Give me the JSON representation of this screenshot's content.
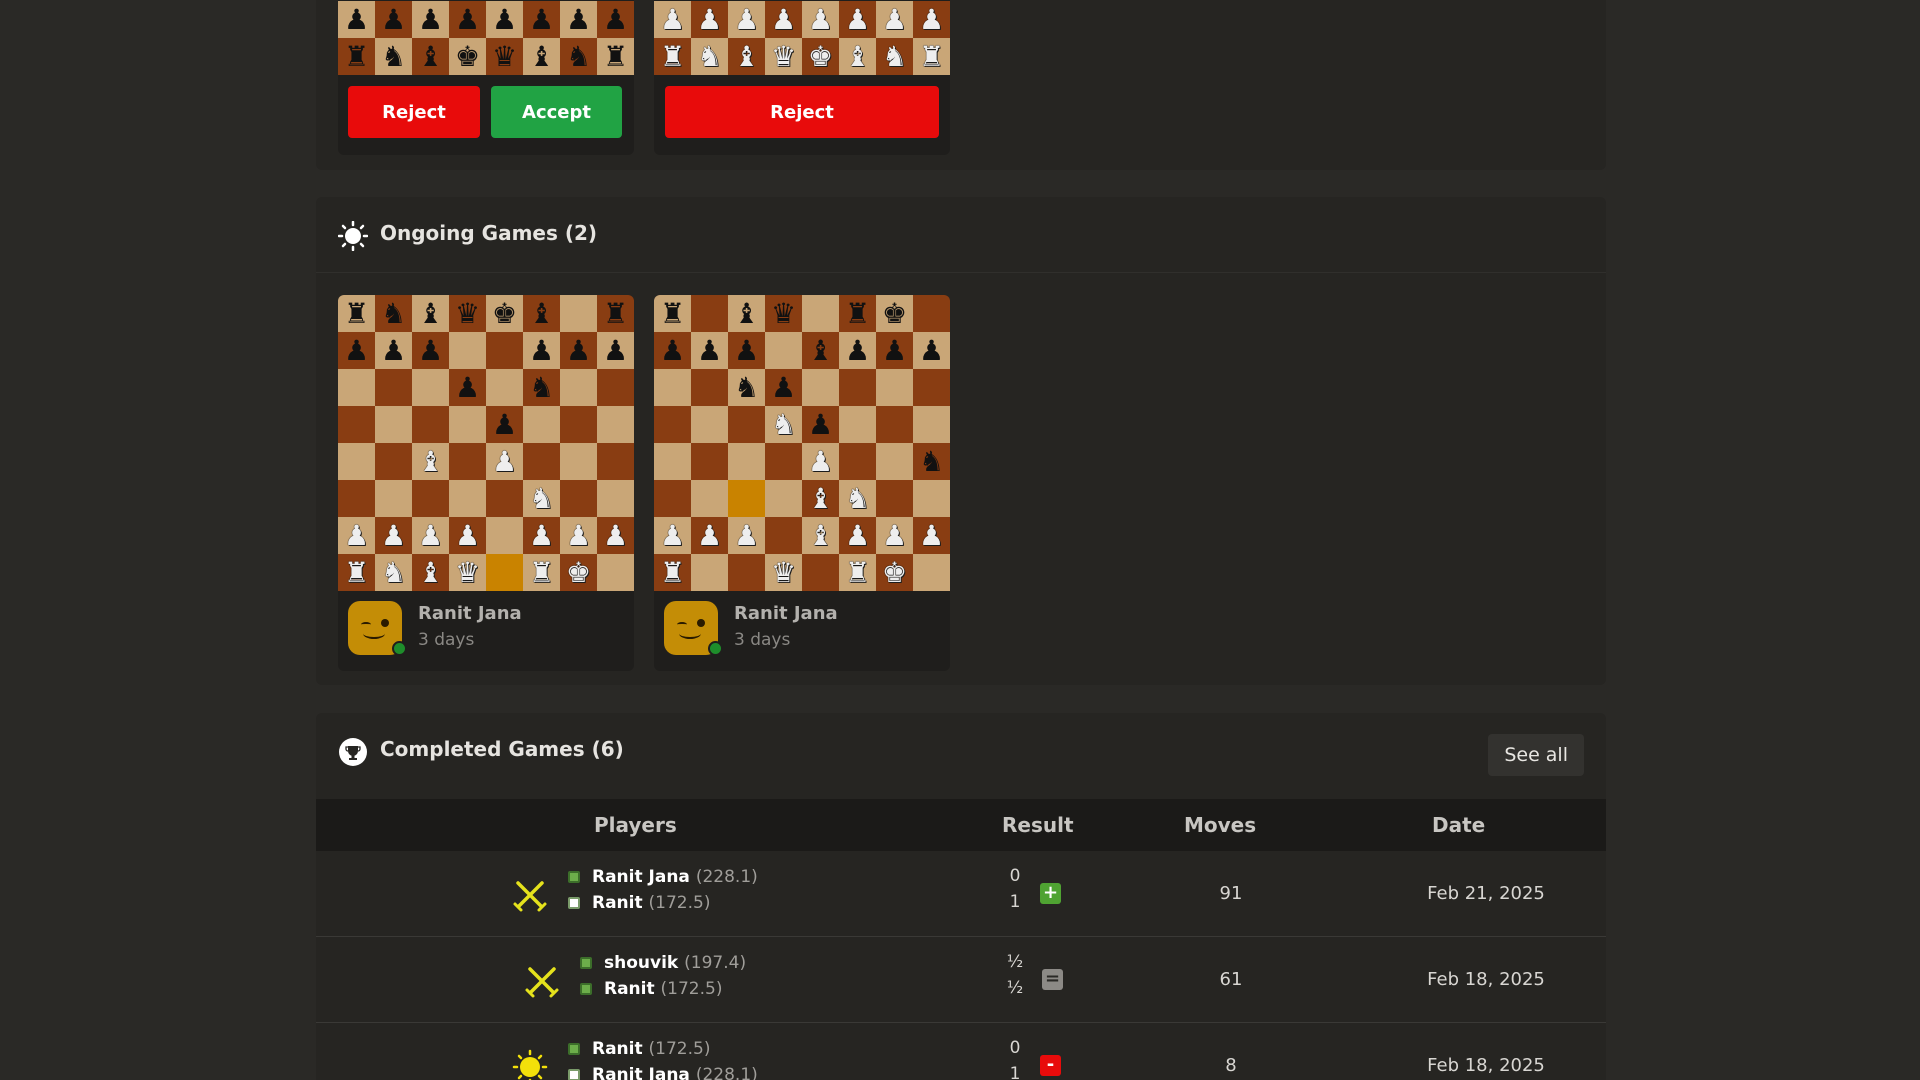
{
  "challenges": {
    "cards": [
      {
        "reject_label": "Reject",
        "accept_label": "Accept"
      },
      {
        "reject_label": "Reject"
      }
    ],
    "boards": [
      {
        "rows": [
          "pppppppp",
          "rnbkqbnr"
        ]
      },
      {
        "rows": [
          "PPPPPPPP",
          "RNBQKBNR"
        ]
      }
    ]
  },
  "ongoing": {
    "title": "Ongoing Games (2)",
    "icon": "sun-icon",
    "games": [
      {
        "player": "Ranit Jana",
        "time": "3 days",
        "board": [
          "rnbqkb.r",
          "ppp..ppp",
          "...p.n..",
          "....p...",
          "..B.P...",
          ".....N..",
          "PPPP.PPP",
          "RNBQ.RK."
        ],
        "highlight": [
          [
            7,
            4
          ]
        ]
      },
      {
        "player": "Ranit Jana",
        "time": "3 days",
        "board": [
          "r.bq.rk.",
          "ppp.bppp",
          "..np....",
          "...Np...",
          "....P..n",
          "....BN..",
          "PPP.BPPP",
          "R..Q.RK."
        ],
        "highlight": [
          [
            5,
            2
          ]
        ]
      }
    ]
  },
  "completed": {
    "title": "Completed Games (6)",
    "icon": "trophy-icon",
    "see_all_label": "See all",
    "columns": {
      "players": "Players",
      "result": "Result",
      "moves": "Moves",
      "date": "Date"
    },
    "rows": [
      {
        "type_icon": "crossed-swords-icon",
        "p1": {
          "name": "Ranit Jana",
          "rating": "(228.1)",
          "color": "green"
        },
        "p2": {
          "name": "Ranit",
          "rating": "(172.5)",
          "color": "white"
        },
        "s1": "0",
        "s2": "1",
        "result": "win",
        "result_symbol": "+",
        "moves": "91",
        "date": "Feb 21, 2025"
      },
      {
        "type_icon": "crossed-swords-icon",
        "p1": {
          "name": "shouvik",
          "rating": "(197.4)",
          "color": "green"
        },
        "p2": {
          "name": "Ranit",
          "rating": "(172.5)",
          "color": "green"
        },
        "s1": "½",
        "s2": "½",
        "result": "draw",
        "result_symbol": "=",
        "moves": "61",
        "date": "Feb 18, 2025"
      },
      {
        "type_icon": "sun-icon",
        "p1": {
          "name": "Ranit",
          "rating": "(172.5)",
          "color": "green"
        },
        "p2": {
          "name": "Ranit Jana",
          "rating": "(228.1)",
          "color": "white"
        },
        "s1": "0",
        "s2": "1",
        "result": "loss",
        "result_symbol": "-",
        "moves": "8",
        "date": "Feb 18, 2025"
      }
    ]
  },
  "colors": {
    "reject": "#e80b0b",
    "accept": "#21a344",
    "light_square": "#c9a677",
    "dark_square": "#893d12",
    "highlight": "#c98300"
  }
}
